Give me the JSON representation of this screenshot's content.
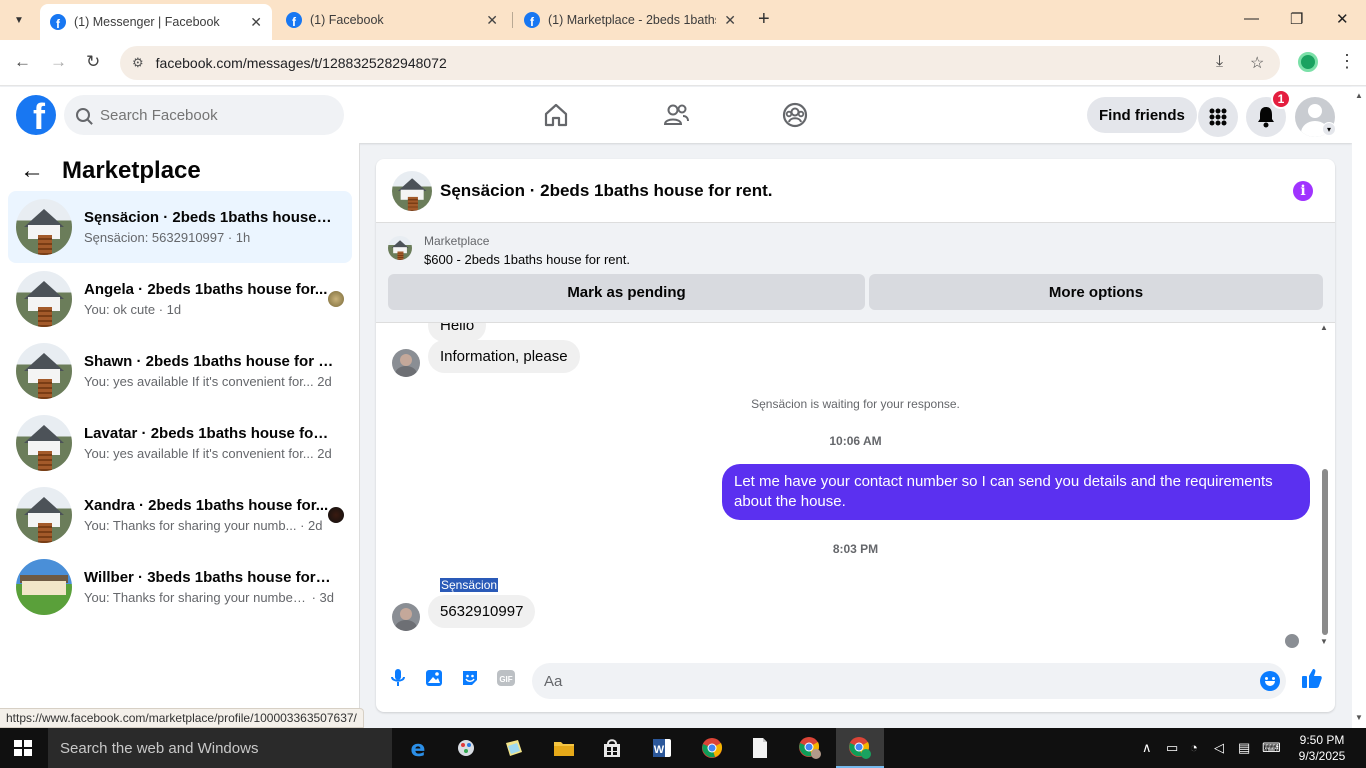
{
  "browser": {
    "tabs": [
      {
        "title": "(1) Messenger | Facebook",
        "active": true
      },
      {
        "title": "(1) Facebook",
        "active": false
      },
      {
        "title": "(1) Marketplace - 2beds 1baths",
        "active": false
      }
    ],
    "url": "facebook.com/messages/t/1288325282948072",
    "status_url": "https://www.facebook.com/marketplace/profile/100003363507637/"
  },
  "fb_nav": {
    "search_placeholder": "Search Facebook",
    "find_friends": "Find friends",
    "notification_count": "1"
  },
  "sidebar": {
    "title": "Marketplace",
    "conversations": [
      {
        "name": "Sęnsäcion · 2beds 1baths house fo...",
        "preview": "Sęnsäcion: 5632910997",
        "time": "· 1h",
        "active": true
      },
      {
        "name": "Angela · 2beds 1baths house for...",
        "preview": "You: ok cute",
        "time": "· 1d",
        "active": false
      },
      {
        "name": "Shawn · 2beds 1baths house for re...",
        "preview": "You: yes available If it's convenient for...",
        "time": "2d",
        "active": false
      },
      {
        "name": "Lavatar · 2beds 1baths house for re...",
        "preview": "You: yes available If it's convenient for...",
        "time": "2d",
        "active": false
      },
      {
        "name": "Xandra · 2beds 1baths house for...",
        "preview": "You: Thanks for sharing your numb...",
        "time": "· 2d",
        "active": false
      },
      {
        "name": "Willber · 3beds 1baths house for re...",
        "preview": "You: Thanks for sharing your number. ...",
        "time": "· 3d",
        "active": false
      }
    ]
  },
  "chat": {
    "title": "Sęnsäcion · 2beds 1baths house for rent.",
    "listing_source": "Marketplace",
    "listing_title": "$600 - 2beds 1baths house for rent.",
    "mark_pending": "Mark as pending",
    "more_options": "More options",
    "messages": {
      "hello": "Hello",
      "info_please": "Information, please",
      "waiting": "Sęnsäcion is waiting for your response.",
      "time1": "10:06 AM",
      "outgoing": "Let me have your contact number so I can send you details and the requirements about the  house.",
      "time2": "8:03 PM",
      "sender": "Sęnsäcion",
      "phone": "5632910997"
    },
    "composer_placeholder": "Aa"
  },
  "taskbar": {
    "search": "Search the web and Windows",
    "time": "9:50 PM",
    "date": "9/3/2025"
  },
  "colors": {
    "fb_blue": "#1877f2",
    "outgoing_bubble": "#5b30f0",
    "notification_red": "#e41e3f",
    "info_purple": "#a033ff"
  }
}
